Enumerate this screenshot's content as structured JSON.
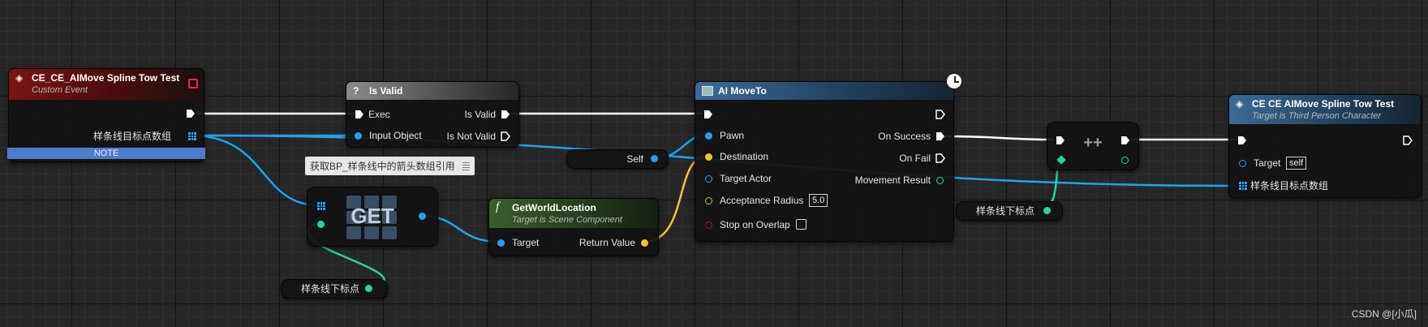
{
  "nodes": {
    "custom_event": {
      "title": "CE_CE_AIMove Spline Tow Test",
      "subtitle": "Custom Event",
      "out_pin": "样条线目标点数组",
      "note": "NOTE"
    },
    "is_valid": {
      "title": "Is Valid",
      "exec_in": "Exec",
      "input_object": "Input Object",
      "is_valid_out": "Is Valid",
      "is_not_valid_out": "Is Not Valid"
    },
    "comment": {
      "text": "获取BP_样条线中的箭头数组引用"
    },
    "get": {
      "label": "GET"
    },
    "index_var_bottom": {
      "label": "样条线下标点"
    },
    "self": {
      "label": "Self"
    },
    "get_world_location": {
      "title": "GetWorldLocation",
      "subtitle": "Target is Scene Component",
      "target": "Target",
      "return_value": "Return Value"
    },
    "ai_moveto": {
      "title": "AI MoveTo",
      "pawn": "Pawn",
      "destination": "Destination",
      "target_actor": "Target Actor",
      "acceptance_radius": "Acceptance Radius",
      "acceptance_radius_value": "5.0",
      "stop_on_overlap": "Stop on Overlap",
      "on_success": "On Success",
      "on_fail": "On Fail",
      "movement_result": "Movement Result"
    },
    "increment": {
      "label": "++"
    },
    "index_var_right": {
      "label": "样条线下标点"
    },
    "ce_call": {
      "title": "CE CE AIMove Spline Tow Test",
      "subtitle": "Target is Third Person Character",
      "target": "Target",
      "target_value": "self",
      "array_pin": "样条线目标点数组"
    }
  },
  "watermark": "CSDN @[小瓜]",
  "colors": {
    "exec": "#ffffff",
    "object": "#1fa3ec",
    "vector": "#f4c430",
    "float": "#9ad94a",
    "bool": "#9a1c1c",
    "int": "#1ed8a0",
    "array": "#2ea5ff"
  }
}
